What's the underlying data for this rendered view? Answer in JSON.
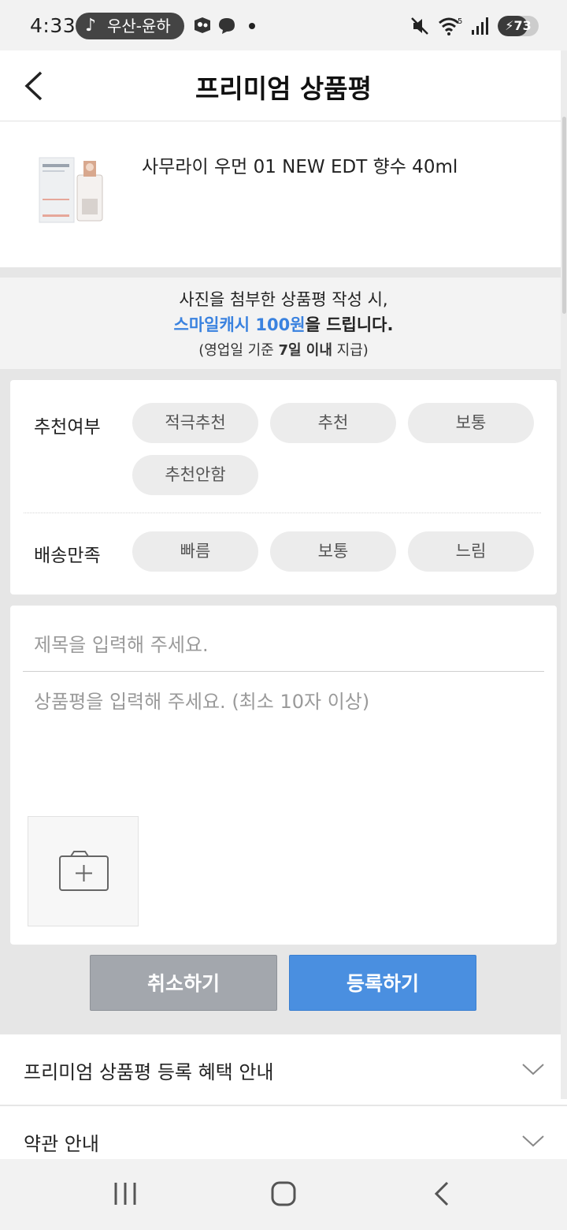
{
  "status_bar": {
    "time": "4:33",
    "media_pill": "우산-윤하",
    "battery": "73",
    "battery_level": 0.73
  },
  "header": {
    "title": "프리미엄 상품평",
    "back_icon": "chevron-left-icon"
  },
  "product": {
    "name": "사무라이 우먼 01 NEW EDT 향수 40ml"
  },
  "banner": {
    "line1": "사진을 첨부한 상품평 작성 시,",
    "line2_highlight": "스마일캐시 100원",
    "line2_rest": "을 드립니다.",
    "line3_pre": "(영업일 기준 ",
    "line3_bold": "7일 이내",
    "line3_post": " 지급)"
  },
  "options": {
    "recommend": {
      "label": "추천여부",
      "chips": [
        "적극추천",
        "추천",
        "보통",
        "추천안함"
      ]
    },
    "delivery": {
      "label": "배송만족",
      "chips": [
        "빠름",
        "보통",
        "느림"
      ]
    }
  },
  "form": {
    "title_placeholder": "제목을 입력해 주세요.",
    "body_placeholder": "상품평을 입력해 주세요. (최소 10자 이상)",
    "photo_icon": "add-photo-icon"
  },
  "buttons": {
    "cancel": "취소하기",
    "submit": "등록하기"
  },
  "accordion": [
    {
      "label": "프리미엄 상품평 등록 혜택 안내"
    },
    {
      "label": "약관 안내"
    }
  ],
  "colors": {
    "accent": "#4a8fe0",
    "highlight": "#3a82df",
    "cancel": "#a3a7ad"
  }
}
